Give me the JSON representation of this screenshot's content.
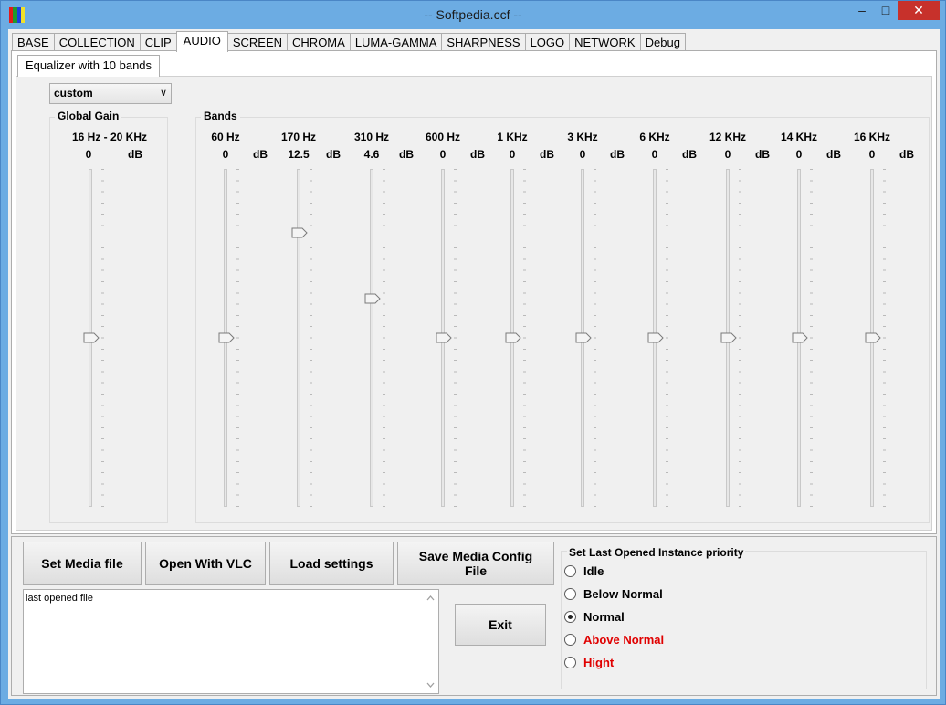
{
  "window": {
    "title": "-- Softpedia.ccf --",
    "minimize": "–",
    "maximize": "□",
    "close": "✕"
  },
  "tabs": [
    {
      "label": "BASE"
    },
    {
      "label": "COLLECTION"
    },
    {
      "label": "CLIP"
    },
    {
      "label": "AUDIO",
      "active": true
    },
    {
      "label": "SCREEN"
    },
    {
      "label": "CHROMA"
    },
    {
      "label": "LUMA-GAMMA"
    },
    {
      "label": "SHARPNESS"
    },
    {
      "label": "LOGO"
    },
    {
      "label": "NETWORK"
    },
    {
      "label": "Debug"
    }
  ],
  "equalizer": {
    "subtab": "Equalizer with 10 bands",
    "preset": {
      "value": "custom",
      "icon": "chevron-down-icon"
    },
    "global_gain": {
      "title": "Global Gain",
      "range": "16 Hz - 20 KHz",
      "value": "0",
      "unit": "dB",
      "position": 0.5
    },
    "bands_title": "Bands",
    "bands": [
      {
        "freq": "60 Hz",
        "value": "0",
        "unit": "dB",
        "position": 0.5
      },
      {
        "freq": "170 Hz",
        "value": "12.5",
        "unit": "dB",
        "position": 0.19
      },
      {
        "freq": "310 Hz",
        "value": "4.6",
        "unit": "dB",
        "position": 0.385
      },
      {
        "freq": "600 Hz",
        "value": "0",
        "unit": "dB",
        "position": 0.5
      },
      {
        "freq": "1 KHz",
        "value": "0",
        "unit": "dB",
        "position": 0.5
      },
      {
        "freq": "3 KHz",
        "value": "0",
        "unit": "dB",
        "position": 0.5
      },
      {
        "freq": "6 KHz",
        "value": "0",
        "unit": "dB",
        "position": 0.5
      },
      {
        "freq": "12 KHz",
        "value": "0",
        "unit": "dB",
        "position": 0.5
      },
      {
        "freq": "14 KHz",
        "value": "0",
        "unit": "dB",
        "position": 0.5
      },
      {
        "freq": "16 KHz",
        "value": "0",
        "unit": "dB",
        "position": 0.5
      }
    ]
  },
  "buttons": {
    "set_media": "Set Media file",
    "open_vlc": "Open With VLC",
    "load_settings": "Load settings",
    "save_config": "Save Media Config File",
    "exit": "Exit"
  },
  "log": {
    "text": "last opened file"
  },
  "priority": {
    "title": "Set Last Opened Instance priority",
    "options": [
      {
        "label": "Idle",
        "selected": false,
        "color": "#000000"
      },
      {
        "label": "Below Normal",
        "selected": false,
        "color": "#000000"
      },
      {
        "label": "Normal",
        "selected": true,
        "color": "#000000"
      },
      {
        "label": "Above Normal",
        "selected": false,
        "color": "#e00000"
      },
      {
        "label": "Hight",
        "selected": false,
        "color": "#e00000"
      }
    ]
  }
}
